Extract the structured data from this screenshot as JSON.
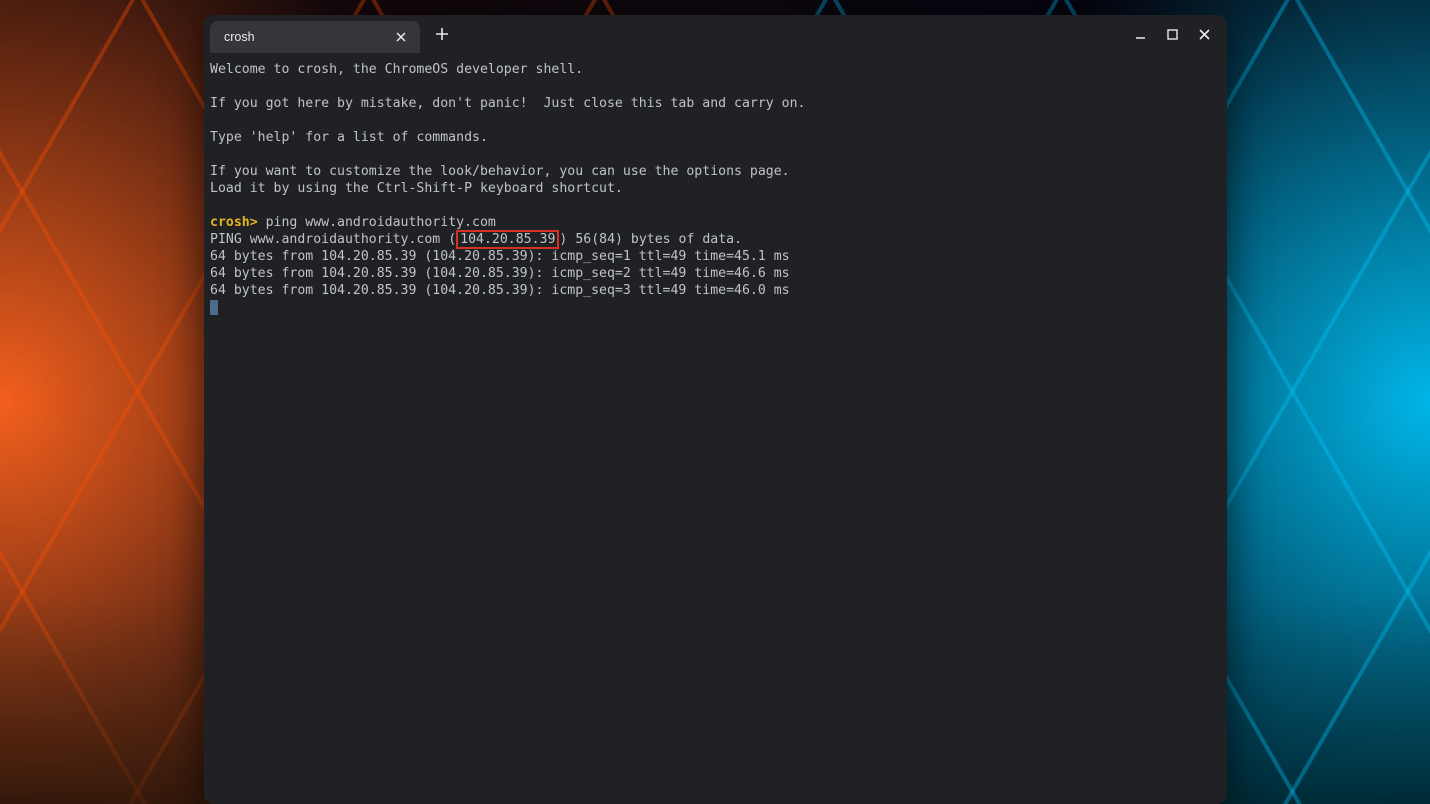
{
  "tab": {
    "title": "crosh"
  },
  "terminal": {
    "welcome": "Welcome to crosh, the ChromeOS developer shell.",
    "mistake": "If you got here by mistake, don't panic!  Just close this tab and carry on.",
    "help": "Type 'help' for a list of commands.",
    "customize1": "If you want to customize the look/behavior, you can use the options page.",
    "customize2": "Load it by using the Ctrl-Shift-P keyboard shortcut.",
    "prompt": "crosh>",
    "command": " ping www.androidauthority.com",
    "ping_prefix": "PING www.androidauthority.com ",
    "ping_ip_parens_open": "(",
    "ping_ip": "104.20.85.39",
    "ping_ip_parens_close": ")",
    "ping_suffix": " 56(84) bytes of data.",
    "reply1": "64 bytes from 104.20.85.39 (104.20.85.39): icmp_seq=1 ttl=49 time=45.1 ms",
    "reply2": "64 bytes from 104.20.85.39 (104.20.85.39): icmp_seq=2 ttl=49 time=46.6 ms",
    "reply3": "64 bytes from 104.20.85.39 (104.20.85.39): icmp_seq=3 ttl=49 time=46.0 ms"
  },
  "colors": {
    "window_bg": "#202124",
    "text": "#c0c3c6",
    "prompt": "#e6b422",
    "highlight_border": "#d93025"
  }
}
